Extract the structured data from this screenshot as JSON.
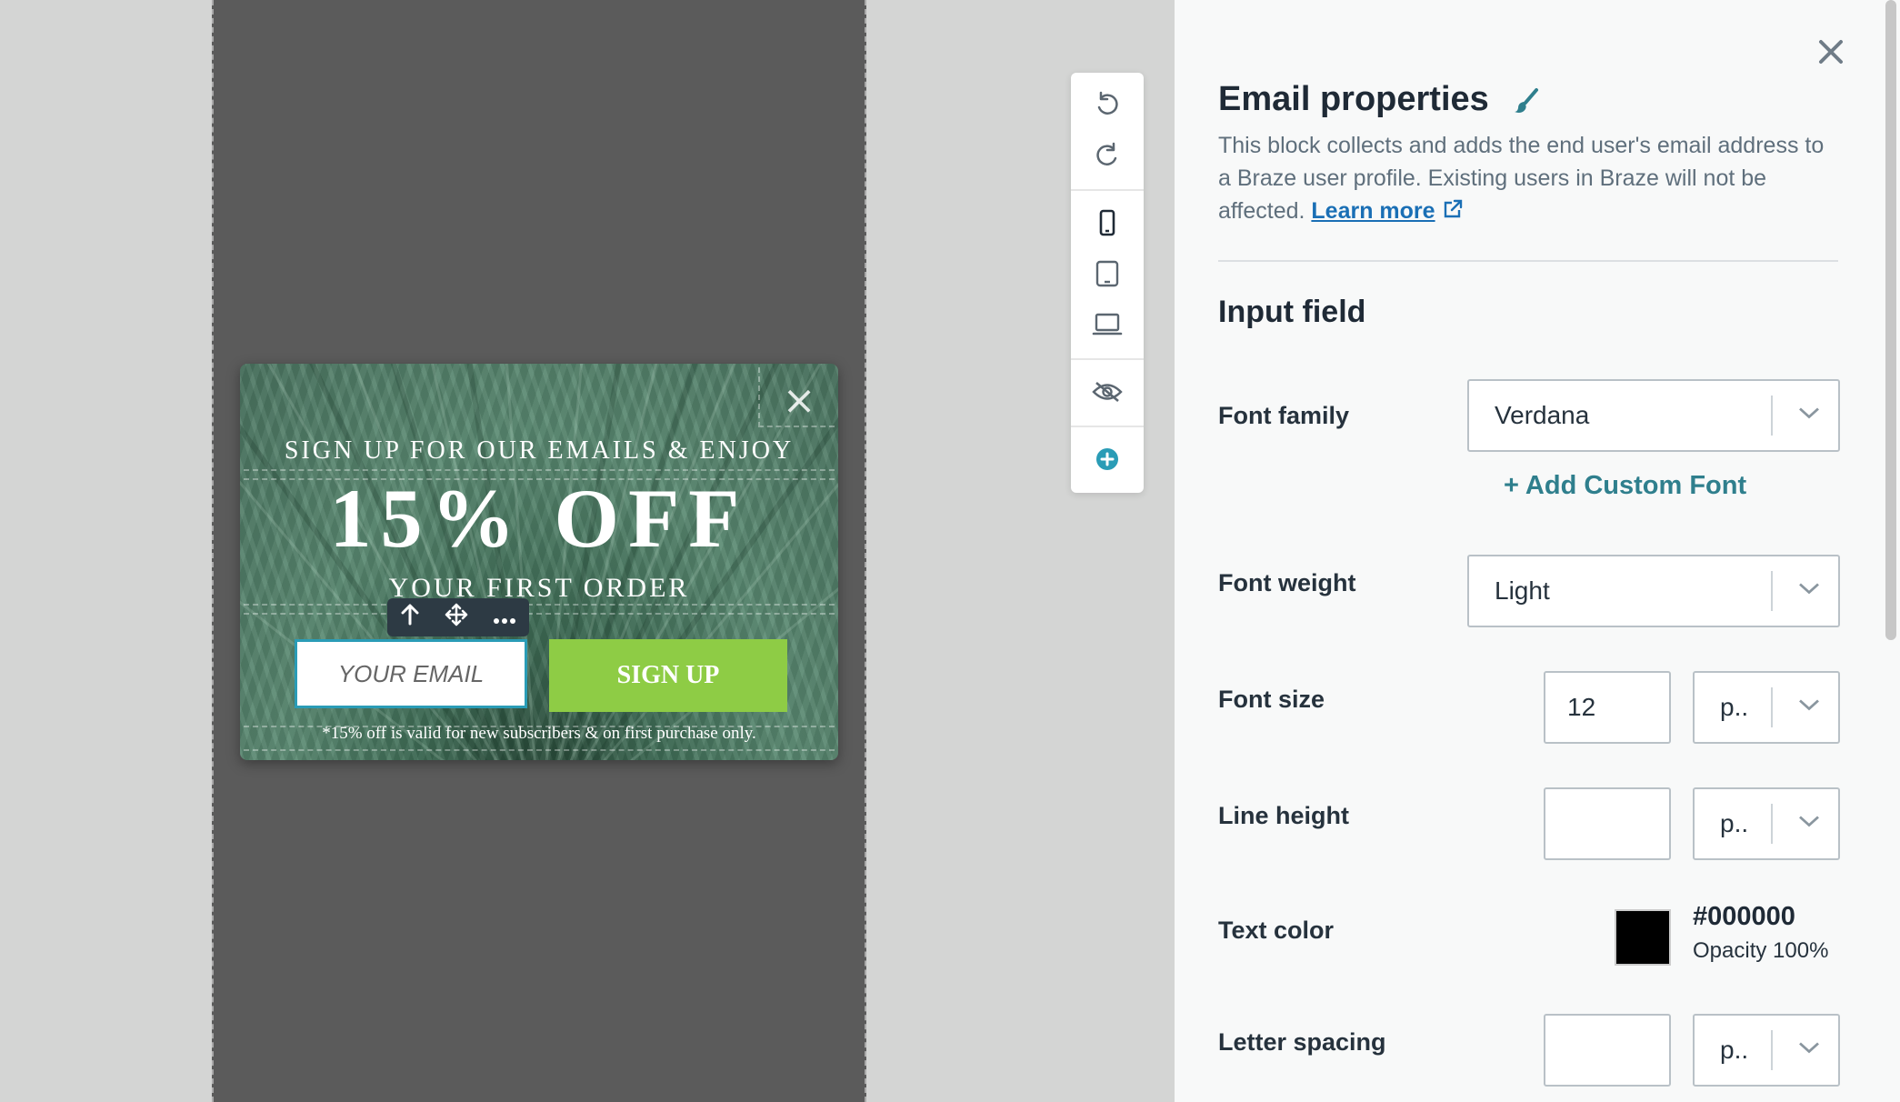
{
  "canvas": {
    "toolbar_icons": [
      "undo-icon",
      "redo-icon",
      "mobile-icon",
      "tablet-icon",
      "laptop-icon",
      "hide-icon",
      "add-icon"
    ],
    "block_toolbar_icons": [
      "arrow-up-icon",
      "move-icon",
      "more-icon"
    ]
  },
  "modal": {
    "headline_small": "SIGN UP FOR OUR EMAILS & ENJOY",
    "headline_big": "15% OFF",
    "headline_sub": "YOUR FIRST ORDER",
    "email_placeholder": "YOUR EMAIL",
    "signup_label": "SIGN UP",
    "disclaimer": "*15% off is valid for new subscribers & on first purchase only.",
    "close_glyph": "×",
    "button_color": "#8ecc45"
  },
  "panel": {
    "title": "Email properties",
    "desc_text": "This block collects and adds the end user's email address to a Braze user profile. Existing users in Braze will not be affected.",
    "learn_more": "Learn more",
    "section_title": "Input field",
    "font_family_label": "Font family",
    "font_family_value": "Verdana",
    "add_custom_font": "+ Add Custom Font",
    "font_weight_label": "Font weight",
    "font_weight_value": "Light",
    "font_size_label": "Font size",
    "font_size_value": "12",
    "font_size_unit": "p..",
    "line_height_label": "Line height",
    "line_height_value": "",
    "line_height_unit": "p..",
    "text_color_label": "Text color",
    "text_color_hex": "#000000",
    "text_color_opacity": "Opacity 100%",
    "letter_spacing_label": "Letter spacing",
    "letter_spacing_value": "",
    "letter_spacing_unit": "p.."
  }
}
